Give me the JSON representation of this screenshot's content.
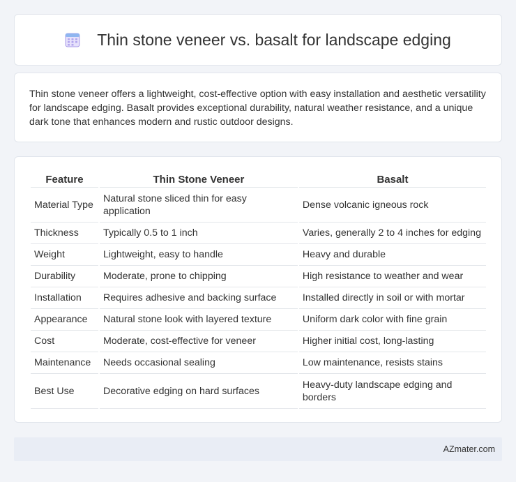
{
  "header": {
    "title": "Thin stone veneer vs. basalt for landscape edging",
    "icon": "calendar-icon"
  },
  "summary": {
    "text": "Thin stone veneer offers a lightweight, cost-effective option with easy installation and aesthetic versatility for landscape edging. Basalt provides exceptional durability, natural weather resistance, and a unique dark tone that enhances modern and rustic outdoor designs."
  },
  "table": {
    "headers": [
      "Feature",
      "Thin Stone Veneer",
      "Basalt"
    ],
    "rows": [
      [
        "Material Type",
        "Natural stone sliced thin for easy application",
        "Dense volcanic igneous rock"
      ],
      [
        "Thickness",
        "Typically 0.5 to 1 inch",
        "Varies, generally 2 to 4 inches for edging"
      ],
      [
        "Weight",
        "Lightweight, easy to handle",
        "Heavy and durable"
      ],
      [
        "Durability",
        "Moderate, prone to chipping",
        "High resistance to weather and wear"
      ],
      [
        "Installation",
        "Requires adhesive and backing surface",
        "Installed directly in soil or with mortar"
      ],
      [
        "Appearance",
        "Natural stone look with layered texture",
        "Uniform dark color with fine grain"
      ],
      [
        "Cost",
        "Moderate, cost-effective for veneer",
        "Higher initial cost, long-lasting"
      ],
      [
        "Maintenance",
        "Needs occasional sealing",
        "Low maintenance, resists stains"
      ],
      [
        "Best Use",
        "Decorative edging on hard surfaces",
        "Heavy-duty landscape edging and borders"
      ]
    ]
  },
  "footer": {
    "text": "AZmater.com"
  },
  "colors": {
    "background": "#f2f4f8",
    "card": "#ffffff",
    "footer": "#e9edf5",
    "icon_accent": "#8b7fd6"
  }
}
